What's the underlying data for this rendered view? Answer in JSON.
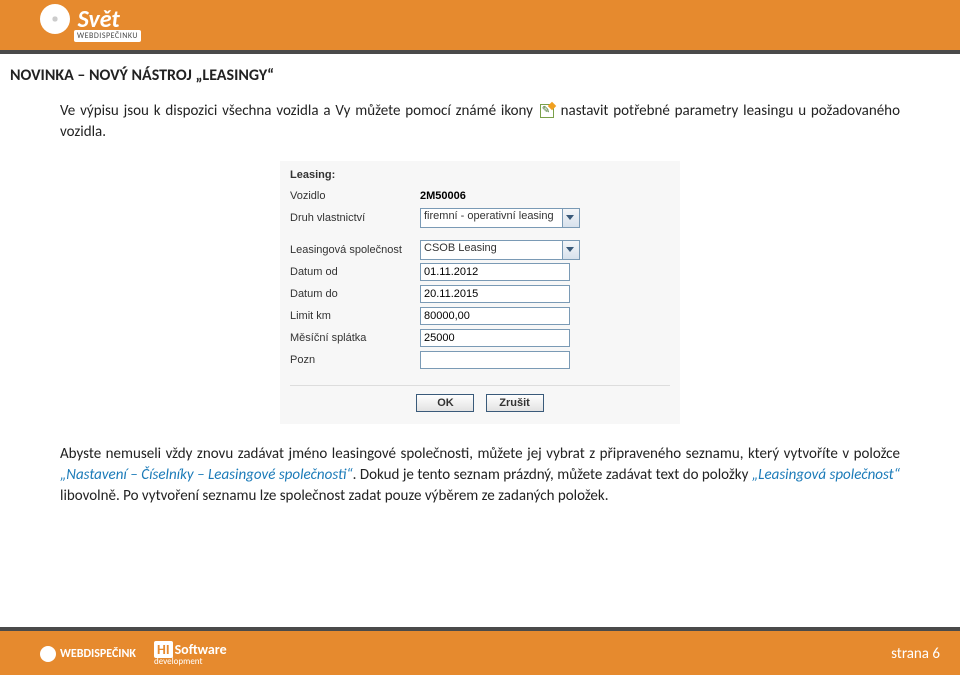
{
  "header": {
    "logo_text": "Svět",
    "logo_sub": "WEBDISPEČINKU"
  },
  "section_title": "NOVINKA – NOVÝ NÁSTROJ „LEASINGY“",
  "para1_a": "Ve výpisu jsou k dispozici všechna vozidla a Vy můžete pomocí známé ikony ",
  "para1_b": " nastavit potřebné parametry leasingu u požadovaného vozidla.",
  "form": {
    "heading": "Leasing:",
    "rows": {
      "vozidlo_lbl": "Vozidlo",
      "vozidlo_val": "2M50006",
      "druh_lbl": "Druh vlastnictví",
      "druh_val": "firemní - operativní leasing",
      "spol_lbl": "Leasingová společnost",
      "spol_val": "CSOB Leasing",
      "od_lbl": "Datum od",
      "od_val": "01.11.2012",
      "do_lbl": "Datum do",
      "do_val": "20.11.2015",
      "limit_lbl": "Limit km",
      "limit_val": "80000,00",
      "splatka_lbl": "Měsíční splátka",
      "splatka_val": "25000",
      "pozn_lbl": "Pozn",
      "pozn_val": ""
    },
    "ok": "OK",
    "cancel": "Zrušit"
  },
  "para2_a": "Abyste nemuseli vždy znovu zadávat jméno leasingové společnosti, můžete jej vybrat z připraveného seznamu, který vytvoříte v položce ",
  "para2_link1": "„Nastavení – Číselníky – Leasingové společnosti“",
  "para2_b": ". Dokud je tento seznam prázdný, můžete zadávat text do položky ",
  "para2_link2": "„Leasingová společnost“",
  "para2_c": " libovolně. Po vytvoření seznamu lze společnost zadat pouze výběrem ze zadaných položek.",
  "footer": {
    "brand1": "WEBDISPEČINK",
    "brand2_hi": "HI",
    "brand2_rest": "Software",
    "brand2_sub": "development",
    "page_prefix": "strana ",
    "page_num": "6"
  }
}
